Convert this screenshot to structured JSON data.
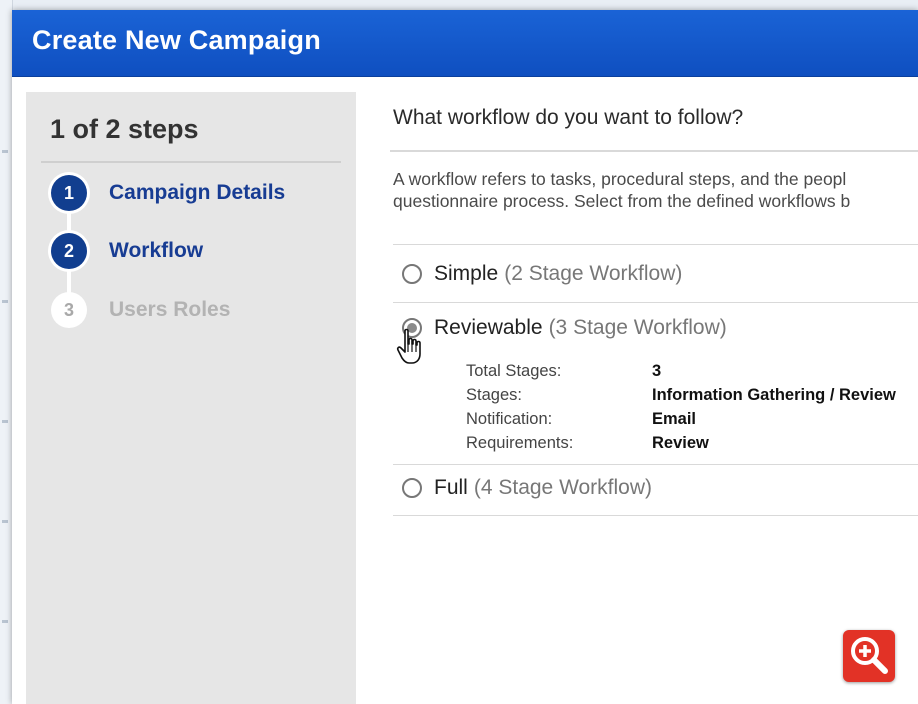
{
  "dialog": {
    "title": "Create New Campaign"
  },
  "steps": {
    "count_label": "1 of 2 steps",
    "items": [
      {
        "number": "1",
        "label": "Campaign Details"
      },
      {
        "number": "2",
        "label": "Workflow"
      },
      {
        "number": "3",
        "label": "Users Roles"
      }
    ]
  },
  "workflow": {
    "question": "What workflow do you want to follow?",
    "description_line1": "A workflow refers to tasks, procedural steps, and the peopl",
    "description_line2": "questionnaire process. Select from the defined workflows b",
    "options": [
      {
        "name": "Simple",
        "detail": "(2 Stage Workflow)",
        "selected": false
      },
      {
        "name": "Reviewable",
        "detail": "(3 Stage Workflow)",
        "selected": true
      },
      {
        "name": "Full",
        "detail": "(4 Stage Workflow)",
        "selected": false
      }
    ],
    "details": [
      {
        "key": "Total Stages:",
        "value": "3"
      },
      {
        "key": "Stages:",
        "value": "Information Gathering / Review"
      },
      {
        "key": "Notification:",
        "value": "Email"
      },
      {
        "key": "Requirements:",
        "value": "Review"
      }
    ]
  },
  "icons": {
    "zoom": "zoom-in-icon",
    "cursor": "hand-pointer-icon"
  },
  "colors": {
    "titlebar": "#1459d0",
    "step_active": "#113e8f",
    "zoom_button": "#e23226"
  }
}
